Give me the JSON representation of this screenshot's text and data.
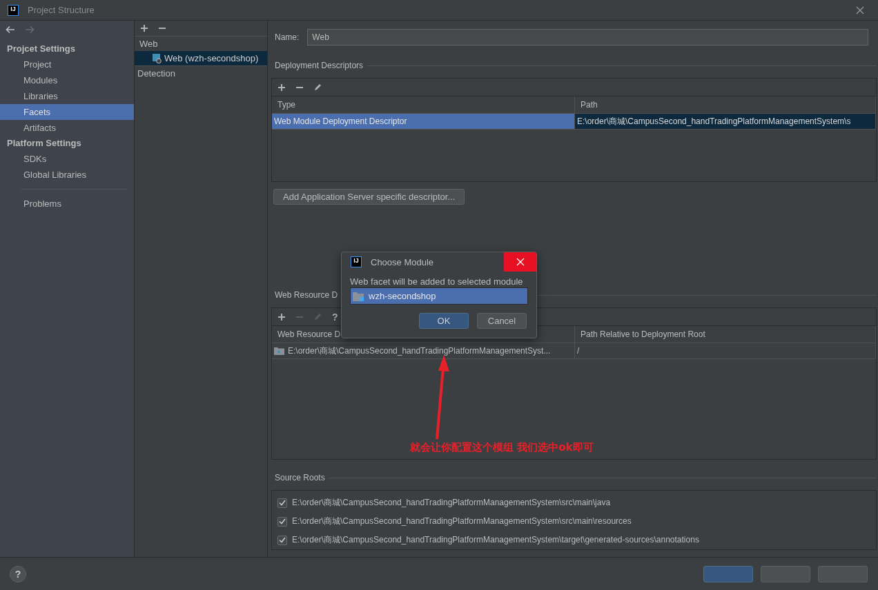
{
  "window": {
    "logo": "IJ",
    "title": "Project Structure"
  },
  "sidebar": {
    "sections": [
      {
        "title": "Projcet Settings",
        "items": [
          {
            "label": "Project",
            "selected": false
          },
          {
            "label": "Modules",
            "selected": false
          },
          {
            "label": "Libraries",
            "selected": false
          },
          {
            "label": "Facets",
            "selected": true
          },
          {
            "label": "Artifacts",
            "selected": false
          }
        ]
      },
      {
        "title": "Platform Settings",
        "items": [
          {
            "label": "SDKs",
            "selected": false
          },
          {
            "label": "Global Libraries",
            "selected": false
          }
        ]
      }
    ],
    "footer_items": [
      {
        "label": "Problems",
        "selected": false
      }
    ]
  },
  "facets_tree": {
    "groups": [
      {
        "label": "Web",
        "children": [
          {
            "label": "Web (wzh-secondshop)",
            "selected": true
          }
        ]
      }
    ],
    "detection": "Detection"
  },
  "name_field": {
    "label": "Name:",
    "value": "Web"
  },
  "deployment_descriptors": {
    "title": "Deployment Descriptors",
    "tools": [
      {
        "kind": "add",
        "disabled": false
      },
      {
        "kind": "remove",
        "disabled": false
      },
      {
        "kind": "edit",
        "disabled": false
      }
    ],
    "columns": [
      "Type",
      "Path"
    ],
    "rows": [
      {
        "cells": [
          "Web Module Deployment Descriptor",
          "E:\\order\\商城\\CampusSecond_handTradingPlatformManagementSystem\\s"
        ],
        "selected": true
      }
    ],
    "add_button": "Add Application Server specific descriptor..."
  },
  "web_resource_directories": {
    "title": "Web Resource D",
    "tools": [
      {
        "kind": "add",
        "disabled": false
      },
      {
        "kind": "remove",
        "disabled": true
      },
      {
        "kind": "edit",
        "disabled": true
      },
      {
        "kind": "help",
        "label": "?",
        "disabled": false
      }
    ],
    "columns": [
      "Web Resource D",
      "Path Relative to Deployment Root"
    ],
    "rows": [
      {
        "cells": [
          "E:\\order\\商城\\CampusSecond_handTradingPlatformManagementSyst...",
          "/"
        ],
        "selected": false
      }
    ]
  },
  "source_roots": {
    "title": "Source Roots",
    "items": [
      {
        "path": "E:\\order\\商城\\CampusSecond_handTradingPlatformManagementSystem\\src\\main\\java",
        "checked": true
      },
      {
        "path": "E:\\order\\商城\\CampusSecond_handTradingPlatformManagementSystem\\src\\main\\resources",
        "checked": true
      },
      {
        "path": "E:\\order\\商城\\CampusSecond_handTradingPlatformManagementSystem\\target\\generated-sources\\annotations",
        "checked": true
      }
    ]
  },
  "footer": {
    "help": "?",
    "buttons": [
      {
        "kind": "default"
      },
      {
        "kind": "normal"
      },
      {
        "kind": "normal"
      }
    ]
  },
  "dialog": {
    "logo": "IJ",
    "title": "Choose Module",
    "message": "Web facet will be added to selected module",
    "modules": [
      {
        "label": "wzh-secondshop",
        "selected": true
      }
    ],
    "buttons": [
      {
        "label": "OK",
        "kind": "default"
      },
      {
        "label": "Cancel",
        "kind": "normal"
      }
    ]
  },
  "annotation": {
    "text": "就会让你配置这个模组 我们选中ok即可"
  }
}
